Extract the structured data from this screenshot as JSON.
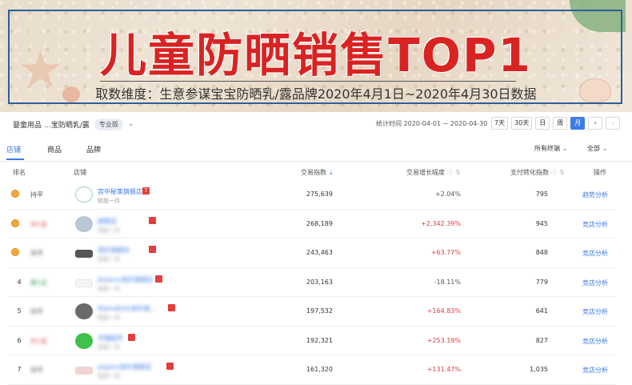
{
  "banner": {
    "title": "儿童防晒销售TOP1",
    "subtitle": "取数维度：生意参谋宝宝防晒乳/露品牌2020年4月1日~2020年4月30日数据"
  },
  "topbar": {
    "breadcrumb": "婴童用品 …宝防晒乳/露",
    "edition_badge": "专业版",
    "range": "统计时间 2020-04-01 ~ 2020-04-30",
    "periods": [
      "7天",
      "30天",
      "日",
      "周",
      "月"
    ],
    "active_period": "月"
  },
  "tabs": {
    "items": [
      "店铺",
      "商品",
      "品牌"
    ],
    "active": "店铺",
    "filter_terminal": "所有终端",
    "filter_all": "全部"
  },
  "table": {
    "headers": {
      "rank": "排名",
      "shop": "店铺",
      "trade_index": "交易指数",
      "growth": "交易增长幅度",
      "conversion": "支付转化指数",
      "action": "操作"
    },
    "rows": [
      {
        "rank": "1",
        "trend": "持平",
        "shop": "宫中秘策旗舰店",
        "sub": "较前一月",
        "trade_index": "275,639",
        "growth": "+2.04%",
        "growth_type": "neg",
        "conversion": "795",
        "action": "趋势分析"
      },
      {
        "rank": "2",
        "trend": "升1名",
        "shop": "旗舰店",
        "sub": "较前一月",
        "trade_index": "268,189",
        "growth": "+2,342.39%",
        "growth_type": "pos",
        "conversion": "945",
        "action": "竞店分析"
      },
      {
        "rank": "3",
        "trend": "持平",
        "shop": "海外旗舰店",
        "sub": "较前一月",
        "trade_index": "243,463",
        "growth": "+63.77%",
        "growth_type": "pos",
        "conversion": "848",
        "action": "竞店分析"
      },
      {
        "rank": "4",
        "trend": "降1名",
        "shop": "Aveeno海外旗舰店",
        "sub": "较前一月",
        "trade_index": "203,163",
        "growth": "-18.11%",
        "growth_type": "neg",
        "conversion": "779",
        "action": "竞店分析"
      },
      {
        "rank": "5",
        "trend": "持平",
        "shop": "MamaKids海外旗...",
        "sub": "较前一月",
        "trade_index": "197,532",
        "growth": "+164.83%",
        "growth_type": "pos",
        "conversion": "641",
        "action": "竞店分析"
      },
      {
        "rank": "6",
        "trend": "升1名",
        "shop": "天猫超市",
        "sub": "较前一月",
        "trade_index": "192,321",
        "growth": "+253.19%",
        "growth_type": "pos",
        "conversion": "827",
        "action": "竞店分析"
      },
      {
        "rank": "7",
        "trend": "持平",
        "shop": "pigeon海外旗舰店",
        "sub": "较前一月",
        "trade_index": "161,320",
        "growth": "+131.47%",
        "growth_type": "pos",
        "conversion": "1,035",
        "action": "竞店分析"
      }
    ]
  },
  "colors": {
    "accent": "#3d7be8",
    "banner_title": "#d92323",
    "positive": "#e23c3c"
  }
}
